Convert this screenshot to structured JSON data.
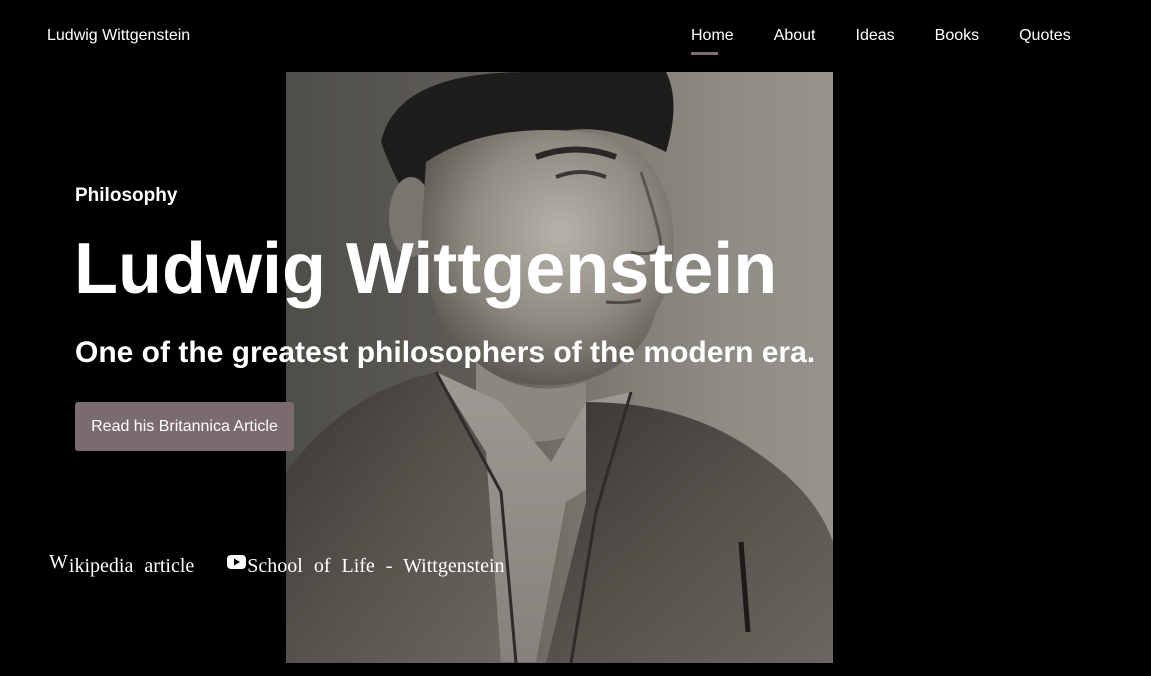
{
  "header": {
    "site_title": "Ludwig Wittgenstein",
    "nav": [
      {
        "label": "Home",
        "active": true
      },
      {
        "label": "About",
        "active": false
      },
      {
        "label": "Ideas",
        "active": false
      },
      {
        "label": "Books",
        "active": false
      },
      {
        "label": "Quotes",
        "active": false
      }
    ]
  },
  "hero": {
    "eyebrow": "Philosophy",
    "title": "Ludwig Wittgenstein",
    "subtitle": "One of the greatest philosophers of the modern era.",
    "cta_label": "Read his Britannica Article"
  },
  "links": {
    "wiki_initial": "W",
    "wiki_rest": "ikipedia article",
    "youtube_label": "School of Life - Wittgenstein"
  },
  "colors": {
    "background": "#000000",
    "accent": "#796b6e",
    "text": "#ffffff"
  },
  "icons": {
    "wiki": "wikipedia-w-icon",
    "youtube": "youtube-icon"
  }
}
